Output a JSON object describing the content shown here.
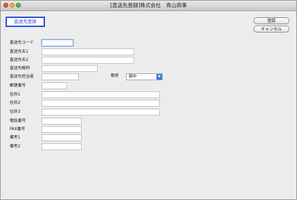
{
  "window": {
    "title": "[直送先登録]株式会社　青山商事"
  },
  "header": {
    "label": "直送先登録"
  },
  "buttons": {
    "register": "登録",
    "cancel": "キャンセル"
  },
  "form": {
    "code_label": "直送先コード",
    "name1_label": "直送先名1",
    "name2_label": "直送先名2",
    "short_name_label": "直送先略称",
    "person_label": "直送先担当者",
    "honorific_label": "敬称",
    "honorific_value": "御中",
    "postal_label": "郵便番号",
    "address1_label": "住所1",
    "address2_label": "住所2",
    "address3_label": "住所3",
    "phone_label": "電話番号",
    "fax_label": "FAX番号",
    "note1_label": "備考1",
    "note2_label": "備考2"
  }
}
